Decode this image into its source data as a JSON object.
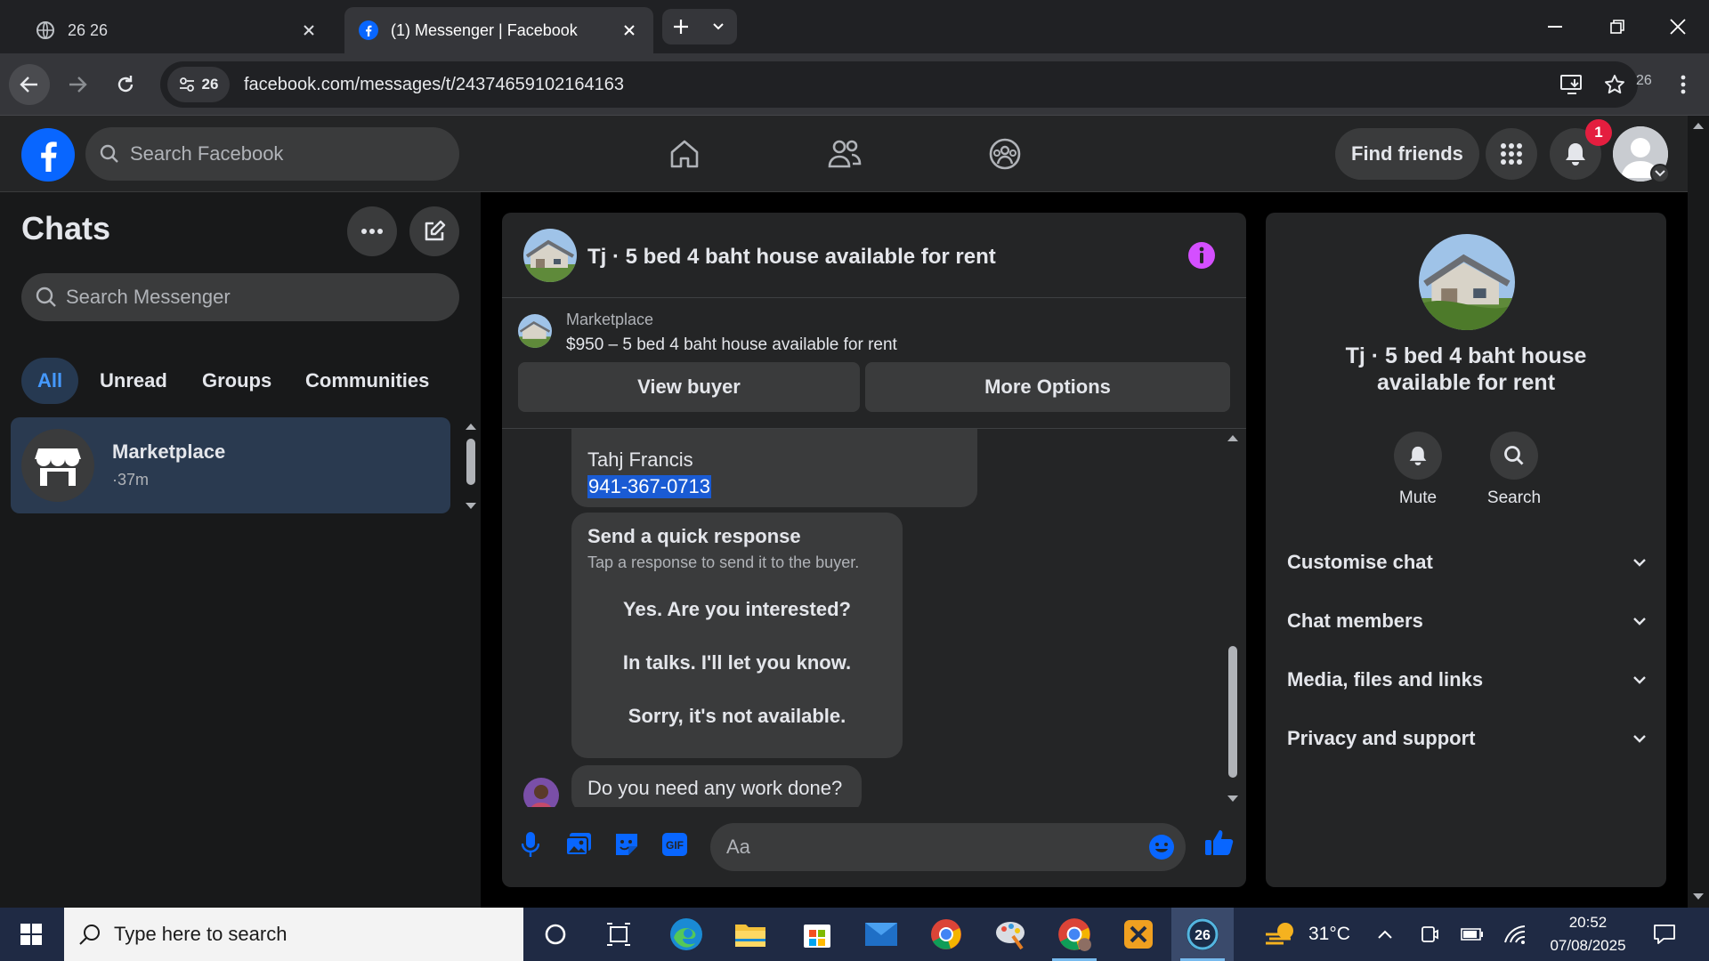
{
  "browser": {
    "tabs": [
      {
        "title": "26 26",
        "active": false,
        "icon": "globe-icon"
      },
      {
        "title": "(1) Messenger | Facebook",
        "active": true,
        "icon": "facebook-icon"
      }
    ],
    "site_badge": "26",
    "url": "facebook.com/messages/t/24374659102164163",
    "extension_count": "26"
  },
  "header": {
    "search_placeholder": "Search Facebook",
    "find_friends": "Find friends",
    "notification_count": "1",
    "brand_color": "#0866ff"
  },
  "sidebar": {
    "title": "Chats",
    "search_placeholder": "Search Messenger",
    "filters": [
      "All",
      "Unread",
      "Groups",
      "Communities"
    ],
    "active_filter": "All",
    "chats": [
      {
        "name": "Marketplace",
        "time": "·37m",
        "icon": "storefront-icon"
      }
    ]
  },
  "conversation": {
    "title": "Tj · 5 bed 4 baht house available for rent",
    "marketplace": {
      "label": "Marketplace",
      "listing": "$950 – 5 bed 4 baht house available for rent",
      "view_buyer": "View buyer",
      "more_options": "More Options"
    },
    "messages": {
      "contact_name": "Tahj Francis",
      "contact_phone": "941-367-0713",
      "quick_response": {
        "title": "Send a quick response",
        "subtitle": "Tap a response to send it to the buyer.",
        "options": [
          "Yes. Are you interested?",
          "In talks. I'll let you know.",
          "Sorry, it's not available."
        ]
      },
      "incoming": "Do you need any work done?"
    },
    "composer_placeholder": "Aa",
    "accent_color": "#0866ff",
    "info_color": "#d44fff"
  },
  "info_panel": {
    "title": "Tj · 5 bed 4 baht house available for rent",
    "actions": [
      {
        "label": "Mute",
        "icon": "bell-icon"
      },
      {
        "label": "Search",
        "icon": "search-icon"
      }
    ],
    "sections": [
      "Customise chat",
      "Chat members",
      "Media, files and links",
      "Privacy and support"
    ]
  },
  "taskbar": {
    "search_placeholder": "Type here to search",
    "weather": "31°C",
    "time": "20:52",
    "date": "07/08/2025",
    "apps": [
      "cortana-icon",
      "task-view-icon",
      "edge-icon",
      "file-explorer-icon",
      "store-icon",
      "mail-icon",
      "chrome-icon",
      "paint-icon",
      "chrome-profile-icon",
      "xodo-icon",
      "browser-26-icon"
    ]
  }
}
